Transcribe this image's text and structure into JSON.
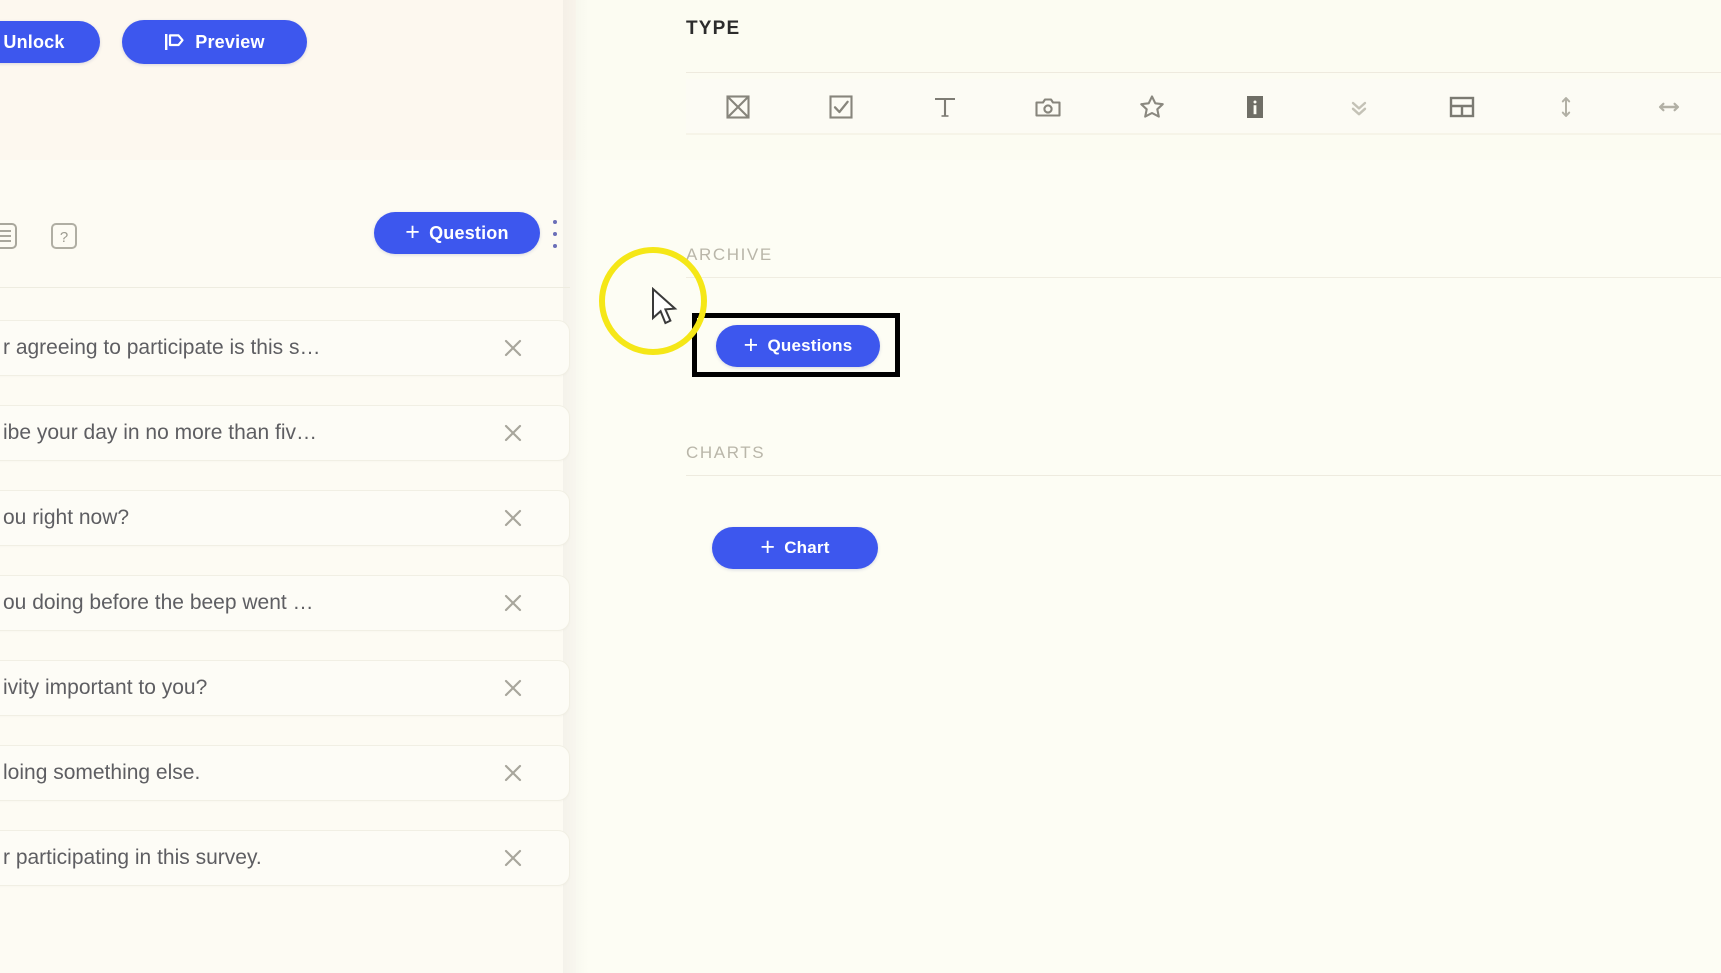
{
  "app": {
    "accent_color": "#3d57ee",
    "background_color": "#fdfdf3",
    "panel_background_color": "#fdfbf3",
    "highlight_color": "#f5e717",
    "annotation_color": "#000000"
  },
  "topbar": {
    "unlock_label": "Unlock",
    "preview_label": "Preview",
    "preview_icon": "preview-flag-icon"
  },
  "type_panel": {
    "title": "TYPE",
    "tools": [
      {
        "name": "multi-select-icon",
        "tooltip": "Multi select"
      },
      {
        "name": "checkbox-icon",
        "tooltip": "Checkbox"
      },
      {
        "name": "text-icon",
        "tooltip": "Text"
      },
      {
        "name": "camera-icon",
        "tooltip": "Photo"
      },
      {
        "name": "star-icon",
        "tooltip": "Rating"
      },
      {
        "name": "info-icon",
        "tooltip": "Info"
      },
      {
        "name": "chevron-double-down-icon",
        "tooltip": "Dropdown"
      },
      {
        "name": "grid-layout-icon",
        "tooltip": "Matrix"
      },
      {
        "name": "vertical-slider-icon",
        "tooltip": "Vertical scale"
      },
      {
        "name": "horizontal-slider-icon",
        "tooltip": "Horizontal scale"
      }
    ]
  },
  "left_panel": {
    "list_icon": "list-lines-icon",
    "help_icon": "question-mark-box-icon",
    "add_question_label": "Question",
    "add_question_plus": "+",
    "kebab_icon": "more-vertical-icon",
    "questions": [
      {
        "text": "r agreeing to participate is this s…",
        "close_icon": "close-icon"
      },
      {
        "text": "ibe your day in no more than fiv…",
        "close_icon": "close-icon"
      },
      {
        "text": "ou right now?",
        "close_icon": "close-icon"
      },
      {
        "text": "ou doing before the beep went …",
        "close_icon": "close-icon"
      },
      {
        "text": "ivity important to you?",
        "close_icon": "close-icon"
      },
      {
        "text": "loing something else.",
        "close_icon": "close-icon"
      },
      {
        "text": "r participating in this survey.",
        "close_icon": "close-icon"
      }
    ]
  },
  "right_panel": {
    "archive": {
      "label": "ARCHIVE",
      "add_label": "Questions",
      "add_plus": "+"
    },
    "charts": {
      "label": "CHARTS",
      "add_label": "Chart",
      "add_plus": "+"
    }
  },
  "overlay": {
    "cursor_highlight": "cursor-highlight-circle",
    "cursor": "mouse-pointer-icon",
    "annotation_target": "add-questions-button"
  }
}
